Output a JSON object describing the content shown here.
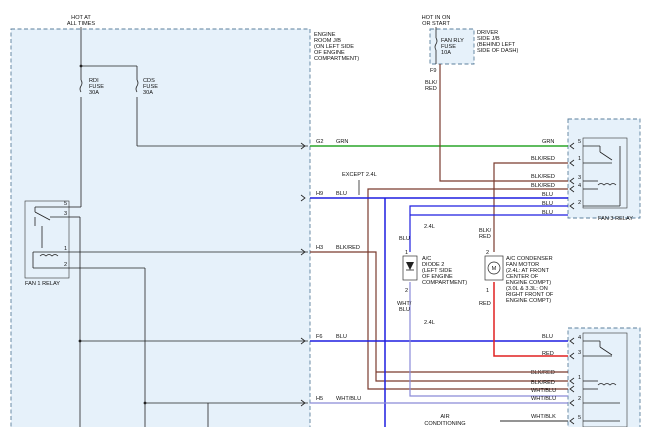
{
  "colors": {
    "grn": "#2aa52a",
    "blk_red": "#7a3b2e",
    "blu": "#1f1fe0",
    "red": "#e02020",
    "wht_blu": "#8a8ad8",
    "wht_blk": "#555555",
    "black": "#222222",
    "box_fill": "#e6f1fa",
    "box_stroke": "#5b7f9c"
  },
  "power": {
    "hot_at_all_times": [
      "HOT AT",
      "ALL TIMES"
    ],
    "hot_in_on": [
      "HOT IN ON",
      "OR START"
    ]
  },
  "engine_room_jb": {
    "label": [
      "ENGINE",
      "ROOM J/B",
      "(ON LEFT SIDE",
      "OF ENGINE",
      "COMPARTMENT)"
    ],
    "rdi_fuse": [
      "RDI",
      "FUSE",
      "30A"
    ],
    "cds_fuse": [
      "CDS",
      "FUSE",
      "30A"
    ],
    "pins": {
      "g2": "G2",
      "h9": "H9",
      "h3": "H3",
      "f6": "F6",
      "h5": "H5"
    }
  },
  "driver_side_jb": {
    "label": [
      "DRIVER",
      "SIDE J/B",
      "(BEHIND LEFT",
      "SIDE OF DASH)"
    ],
    "fuse": [
      "FAN RLY",
      "FUSE",
      "10A"
    ],
    "pin": "F9",
    "wire": [
      "BLK/",
      "RED"
    ]
  },
  "fan1_relay": {
    "label": "FAN 1 RELAY",
    "pins": [
      "5",
      "3",
      "1",
      "2"
    ]
  },
  "fan3_relay": {
    "label": "FAN 3 RELAY",
    "pins": [
      "5",
      "1",
      "3",
      "4",
      "2"
    ]
  },
  "relay_lower": {
    "pins": [
      "4",
      "3",
      "1",
      "2",
      "5"
    ]
  },
  "wires": {
    "grn": "GRN",
    "blk_red": "BLK/RED",
    "blu": "BLU",
    "red": "RED",
    "wht_blu": "WHT/BLU",
    "wht_blk": "WHT/BLK",
    "except_24l": "EXCEPT 2.4L",
    "l24": "2.4L"
  },
  "ac_diode": {
    "label": [
      "A/C",
      "DIODE 2",
      "(LEFT SIDE",
      "OF ENGINE",
      "COMPARTMENT)"
    ],
    "pin_top": "1",
    "pin_bottom": "2",
    "wire_top": "BLU",
    "wire_bottom": [
      "WHT/",
      "BLU"
    ]
  },
  "ac_condenser_fan": {
    "label": [
      "A/C CONDENSER",
      "FAN MOTOR",
      "(2.4L: AT FRONT",
      "CENTER OF",
      "ENGINE COMPT)",
      "(3.0L & 3.3L: ON",
      "RIGHT FRONT OF",
      "ENGINE COMPT)"
    ],
    "pin_top": "2",
    "pin_bottom": "1",
    "wire_top": [
      "BLK/",
      "RED"
    ],
    "wire_bottom": "RED",
    "symbol": "M"
  },
  "air_conditioning": [
    "AIR",
    "CONDITIONING"
  ]
}
